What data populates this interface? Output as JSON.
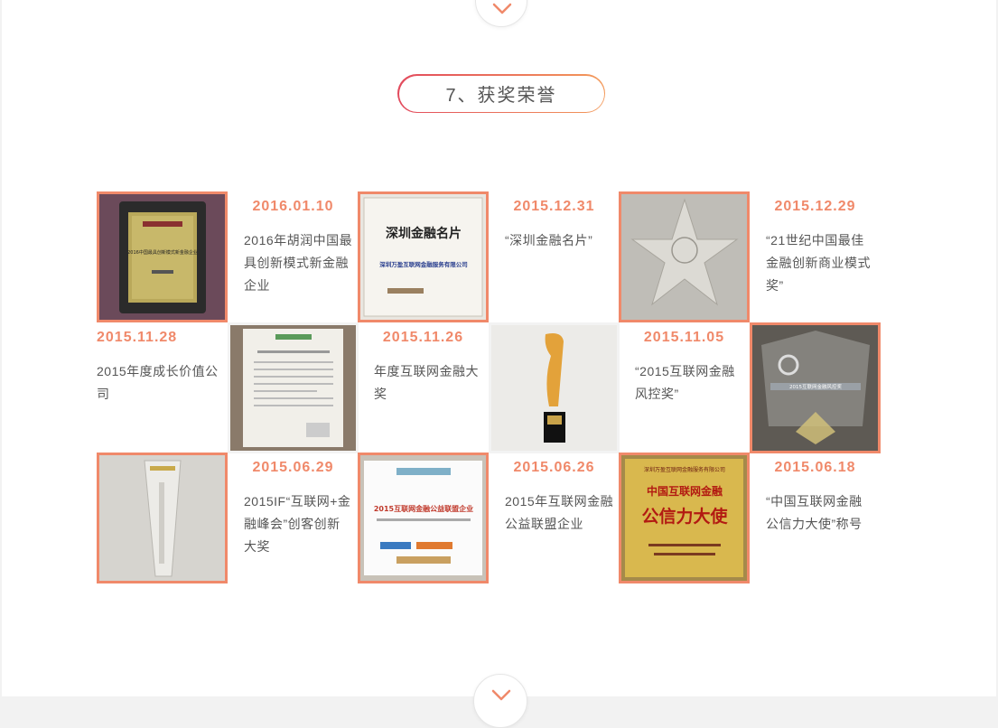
{
  "section": {
    "title": "7、获奖荣誉"
  },
  "colors": {
    "accent": "#f0896a",
    "title_gradient_start": "#e24a5d",
    "title_gradient_end": "#f39a5a"
  },
  "awards": [
    {
      "date": "2016.01.10",
      "desc": "2016年胡润中国最具创新模式新金融企业",
      "plaque_text": "2016中国最具创新模式新金融企业"
    },
    {
      "date": "2015.12.31",
      "desc": "“深圳金融名片”",
      "plaque_title": "深圳金融名片",
      "plaque_text": "深圳万盈互联网金融服务有限公司"
    },
    {
      "date": "2015.12.29",
      "desc": "“21世纪中国最佳金融创新商业模式奖”"
    },
    {
      "date": "2015.11.28",
      "desc": "2015年度成长价值公司"
    },
    {
      "date": "2015.11.26",
      "desc": "年度互联网金融大奖"
    },
    {
      "date": "2015.11.05",
      "desc": "“2015互联网金融风控奖”",
      "plaque_text": "2015互联网金融风控奖"
    },
    {
      "date": "2015.06.29",
      "desc": "2015IF“互联网+金融峰会”创客创新大奖"
    },
    {
      "date": "2015.06.26",
      "desc": "2015年互联网金融公益联盟企业",
      "plaque_title": "2015互联网金融公益联盟企业"
    },
    {
      "date": "2015.06.18",
      "desc": "“中国互联网金融公信力大使”称号",
      "plaque_title": "中国互联网金融",
      "plaque_title2": "公信力大使",
      "plaque_text": "深圳万盈互联网金融服务有限公司"
    }
  ]
}
